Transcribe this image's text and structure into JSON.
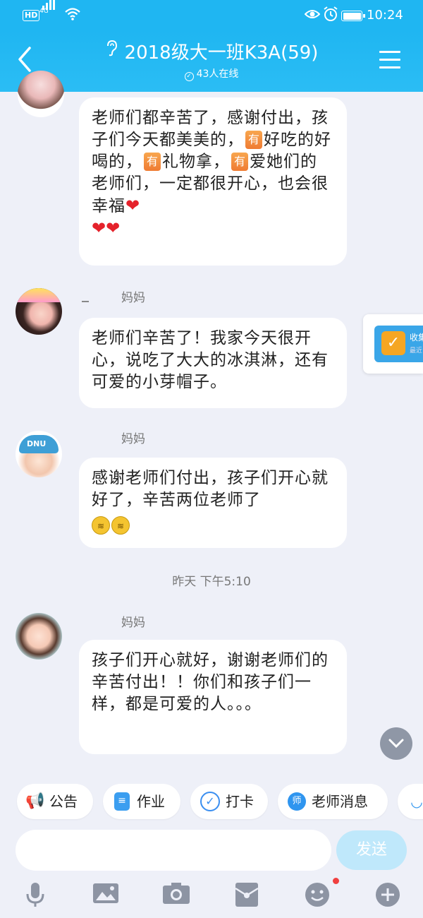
{
  "statusbar": {
    "hd": "HD",
    "network": "4G",
    "time": "10:24"
  },
  "header": {
    "title": "2018级大一班K3A(59)",
    "online": "43人在线"
  },
  "messages": [
    {
      "sender": "",
      "parts": [
        "老师们都辛苦了，感谢付出，孩子们今天都美美的，",
        "好吃的好喝的，",
        "礼物拿，",
        "爱她们的老师们，一定都很开心，也会很幸福"
      ],
      "tag": "有",
      "hearts": "❤\n❤❤"
    },
    {
      "sender": "妈妈",
      "text": "老师们辛苦了！我家今天很开心，说吃了大大的冰淇淋，还有可爱的小芽帽子。"
    },
    {
      "sender": "妈妈",
      "text": "感谢老师们付出，孩子们开心就好了，辛苦两位老师了"
    },
    {
      "sender": "妈妈",
      "text": "孩子们开心就好，谢谢老师们的辛苦付出！！你们和孩子们一样，都是可爱的人。。。"
    }
  ],
  "timestamp": "昨天 下午5:10",
  "side_card": {
    "title": "收集",
    "subtitle": "最近"
  },
  "chips": [
    {
      "label": "公告",
      "color": "#1aa1f0"
    },
    {
      "label": "作业",
      "color": "#3b9ef0"
    },
    {
      "label": "打卡",
      "color": "#3a8ef0"
    },
    {
      "label": "老师消息",
      "color": "#2f95ef",
      "icon_text": "师"
    }
  ],
  "composer": {
    "send_label": "发送"
  },
  "icons": [
    "voice-icon",
    "image-icon",
    "camera-icon",
    "red-envelope-icon",
    "emoji-icon",
    "plus-icon"
  ]
}
